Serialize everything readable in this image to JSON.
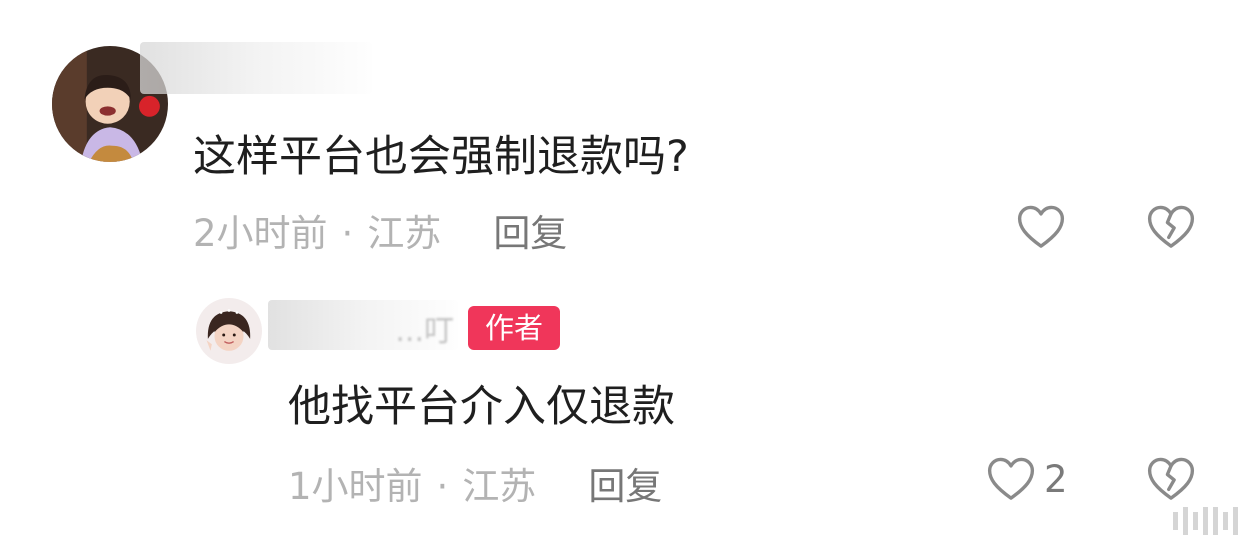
{
  "comments": [
    {
      "text": "这样平台也会强制退款吗?",
      "time": "2小时前",
      "separator": "·",
      "location": "江苏",
      "reply_label": "回复",
      "like_count": "",
      "like_icon": "heart-outline",
      "dislike_icon": "broken-heart-outline",
      "avatar": "child-photo-red-background"
    },
    {
      "username_partial": "...叮",
      "author_badge": "作者",
      "badge_color": "#f0365a",
      "text": "他找平台介入仅退款",
      "time": "1小时前",
      "separator": "·",
      "location": "江苏",
      "reply_label": "回复",
      "like_count": "2",
      "like_icon": "heart-outline",
      "dislike_icon": "broken-heart-outline",
      "avatar": "girl-photo-peace-sign"
    }
  ]
}
